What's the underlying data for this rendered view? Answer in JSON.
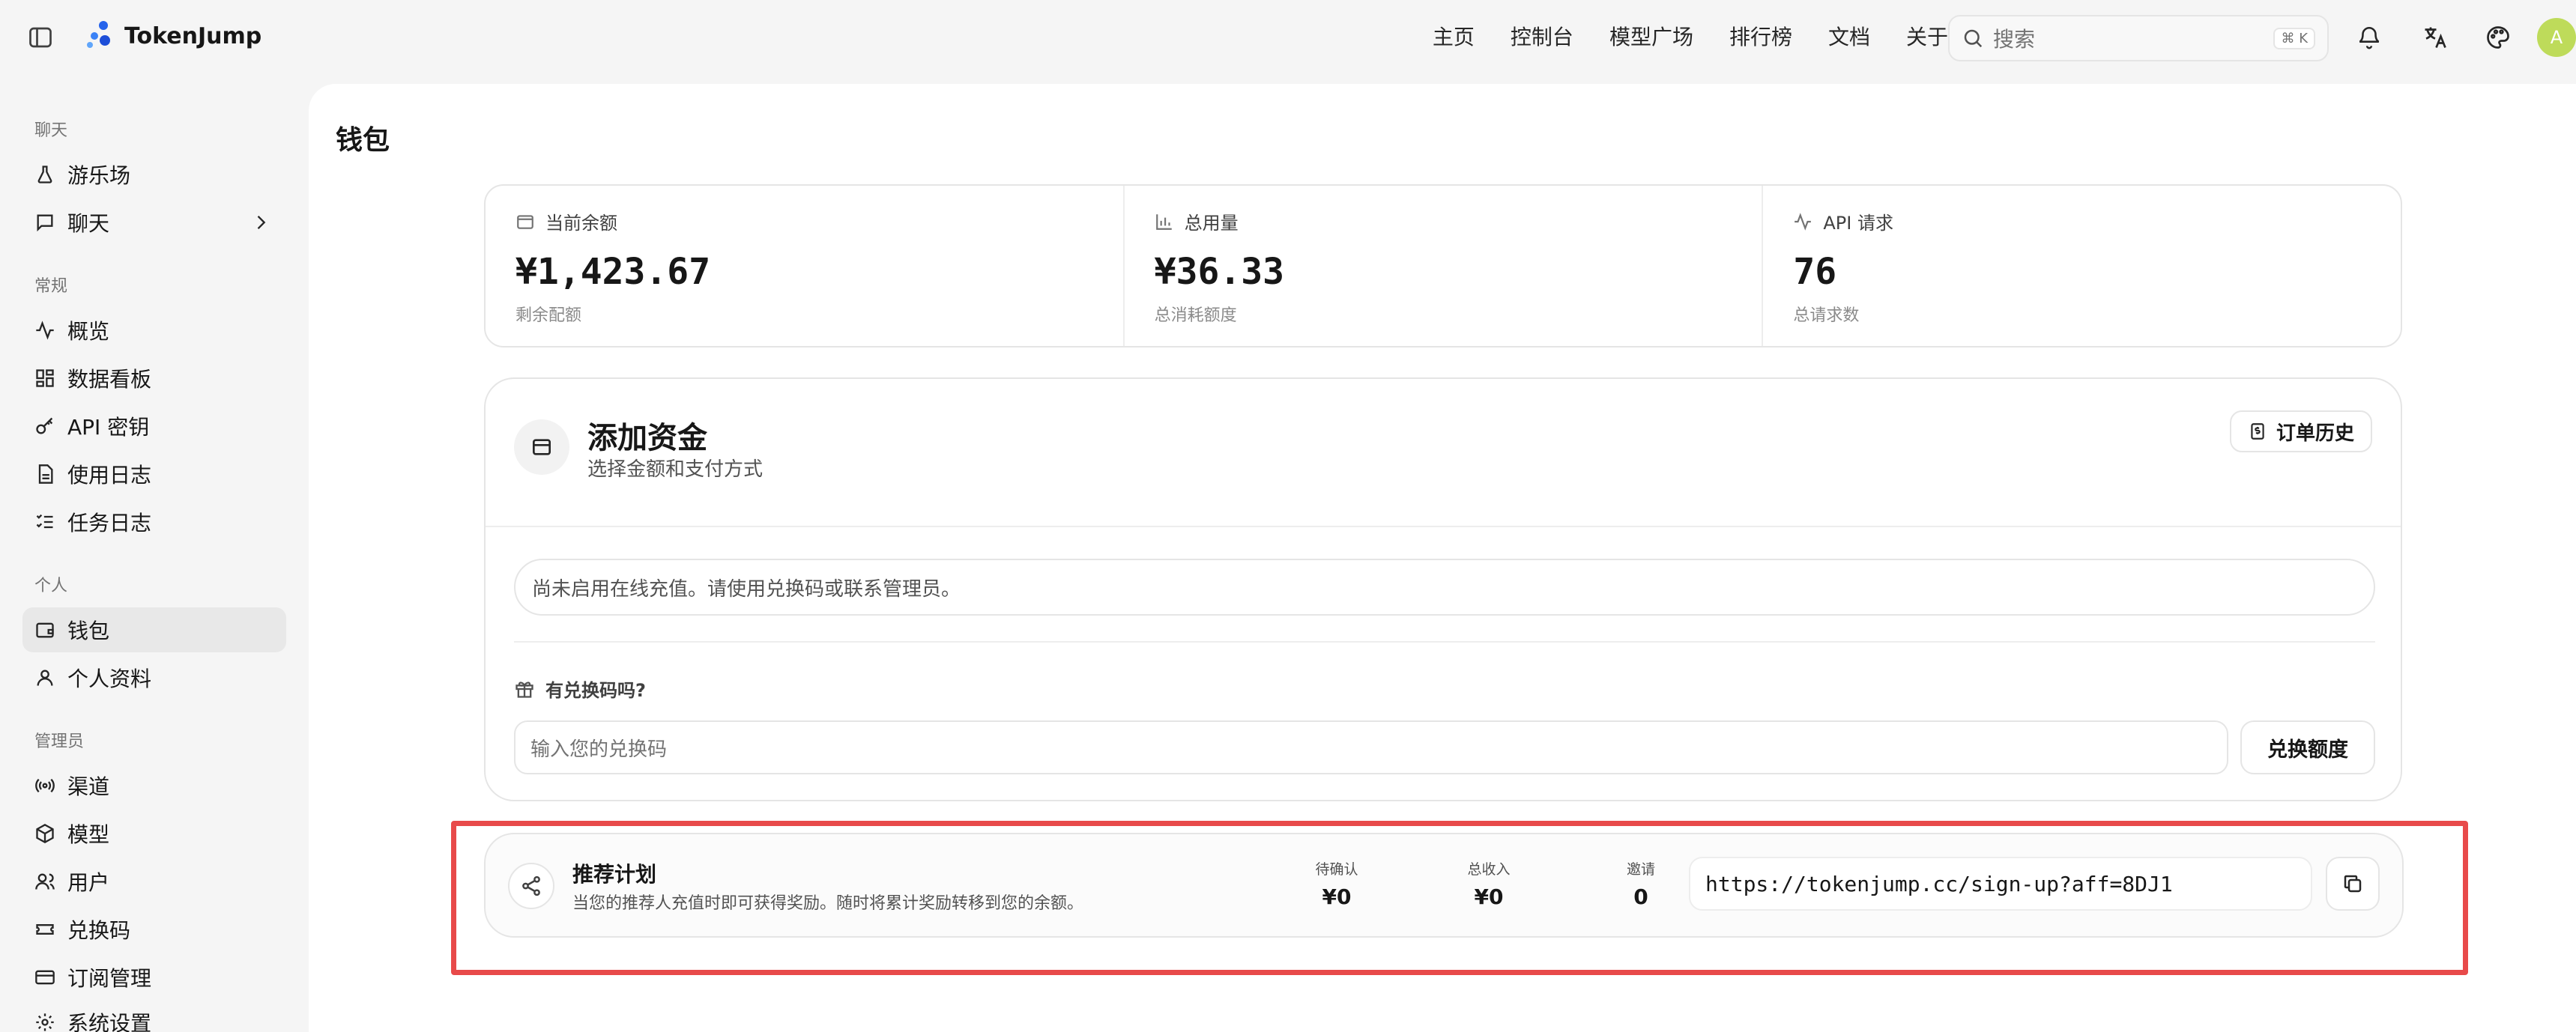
{
  "app": {
    "name": "TokenJump",
    "avatar_letter": "A"
  },
  "topnav": {
    "items": [
      "主页",
      "控制台",
      "模型广场",
      "排行榜",
      "文档",
      "关于"
    ],
    "search_placeholder": "搜索",
    "search_shortcut": "⌘ K"
  },
  "sidebar": {
    "groups": {
      "chat": "聊天",
      "general": "常规",
      "personal": "个人",
      "admin": "管理员"
    },
    "items": {
      "playground": "游乐场",
      "chat": "聊天",
      "overview": "概览",
      "dashboard": "数据看板",
      "api_keys": "API 密钥",
      "usage_logs": "使用日志",
      "task_logs": "任务日志",
      "wallet": "钱包",
      "profile": "个人资料",
      "channels": "渠道",
      "models": "模型",
      "users": "用户",
      "redemption": "兑换码",
      "subscriptions": "订阅管理",
      "settings": "系统设置"
    },
    "active": "wallet"
  },
  "page": {
    "title": "钱包"
  },
  "stats": {
    "balance": {
      "label": "当前余额",
      "value": "¥1,423.67",
      "sub": "剩余配额"
    },
    "usage": {
      "label": "总用量",
      "value": "¥36.33",
      "sub": "总消耗额度"
    },
    "requests": {
      "label": "API 请求",
      "value": "76",
      "sub": "总请求数"
    }
  },
  "add_funds": {
    "title": "添加资金",
    "subtitle": "选择金额和支付方式",
    "order_history": "订单历史",
    "notice": "尚未启用在线充值。请使用兑换码或联系管理员。",
    "redeem_question": "有兑换码吗?",
    "redeem_placeholder": "输入您的兑换码",
    "redeem_button": "兑换额度"
  },
  "referral": {
    "title": "推荐计划",
    "description": "当您的推荐人充值时即可获得奖励。随时将累计奖励转移到您的余额。",
    "pending_label": "待确认",
    "pending_value": "¥0",
    "income_label": "总收入",
    "income_value": "¥0",
    "invites_label": "邀请",
    "invites_value": "0",
    "link": "https://tokenjump.cc/sign-up?aff=8DJ1"
  },
  "colors": {
    "highlight": "#e84a4a",
    "avatar": "#bedb5a",
    "brand": "#2563eb"
  }
}
